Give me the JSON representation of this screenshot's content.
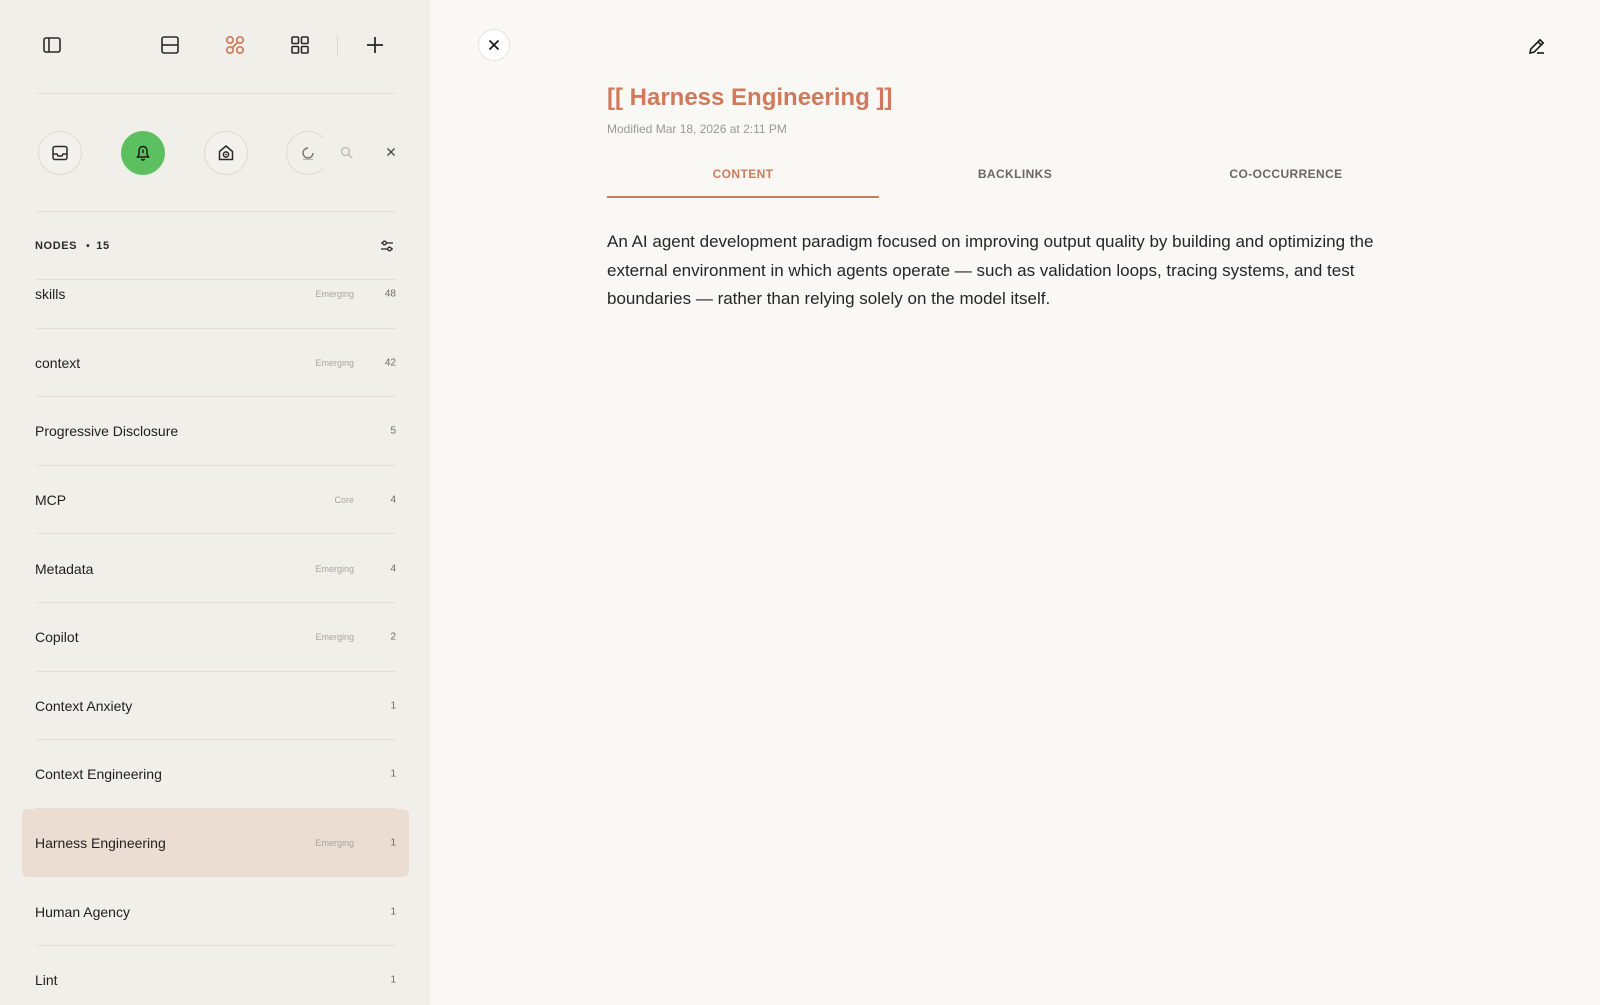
{
  "sidebar": {
    "toolbar": {
      "icons": [
        "sidebar-toggle-icon",
        "split-view-icon",
        "graph-icon",
        "grid-icon",
        "plus-icon"
      ],
      "accent": "#cf7a5b"
    },
    "filters": {
      "icons": [
        "inbox-icon",
        "bell-icon",
        "robot-icon"
      ],
      "active_color": "#5cbf60",
      "search_placeholder": ""
    },
    "nodes_header": {
      "label": "NODES",
      "count": "15"
    },
    "nodes": [
      {
        "name": "skills",
        "badge": "Emerging",
        "count": "48"
      },
      {
        "name": "context",
        "badge": "Emerging",
        "count": "42"
      },
      {
        "name": "Progressive Disclosure",
        "badge": "",
        "count": "5"
      },
      {
        "name": "MCP",
        "badge": "Core",
        "count": "4"
      },
      {
        "name": "Metadata",
        "badge": "Emerging",
        "count": "4"
      },
      {
        "name": "Copilot",
        "badge": "Emerging",
        "count": "2"
      },
      {
        "name": "Context Anxiety",
        "badge": "",
        "count": "1"
      },
      {
        "name": "Context Engineering",
        "badge": "",
        "count": "1"
      },
      {
        "name": "Harness Engineering",
        "badge": "Emerging",
        "count": "1",
        "selected": true
      },
      {
        "name": "Human Agency",
        "badge": "",
        "count": "1"
      },
      {
        "name": "Lint",
        "badge": "",
        "count": "1"
      }
    ]
  },
  "main": {
    "title": "[[ Harness Engineering ]]",
    "modified": "Modified Mar 18, 2026 at 2:11 PM",
    "tabs": [
      {
        "label": "CONTENT",
        "active": true
      },
      {
        "label": "BACKLINKS",
        "active": false
      },
      {
        "label": "CO-OCCURRENCE",
        "active": false
      }
    ],
    "content": "An AI agent development paradigm focused on improving output quality by building and optimizing the external environment in which agents operate — such as validation loops, tracing systems, and test boundaries — rather than relying solely on the model itself.",
    "title_color": "#cf7a5b"
  }
}
